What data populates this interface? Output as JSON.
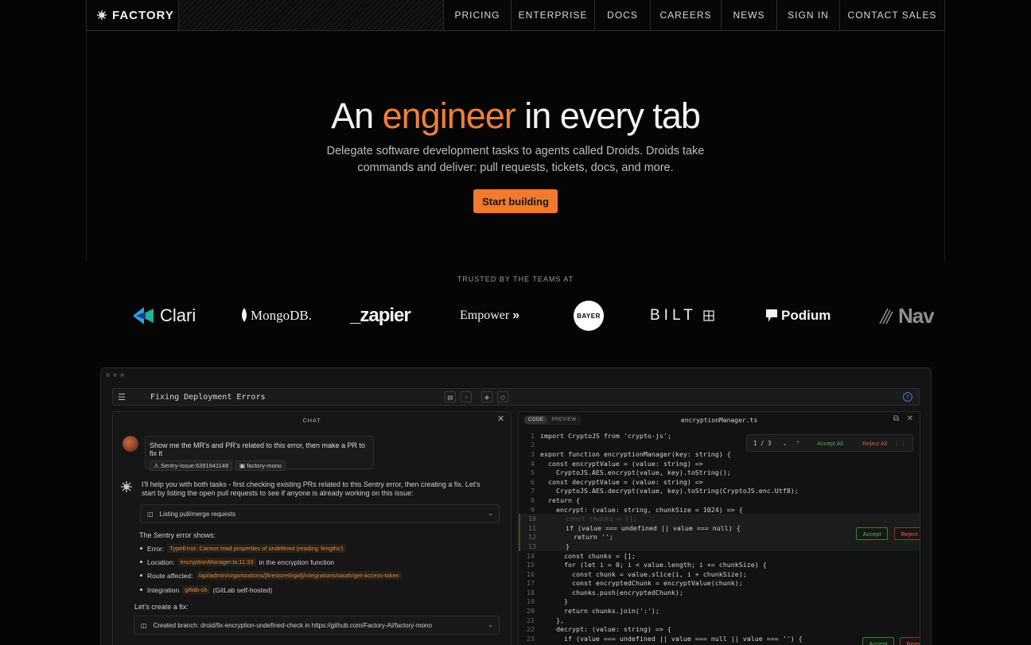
{
  "nav": {
    "brand": "FACTORY",
    "links": [
      "PRICING",
      "ENTERPRISE",
      "DOCS",
      "CAREERS",
      "NEWS",
      "SIGN IN",
      "CONTACT SALES"
    ]
  },
  "hero": {
    "title_pre": "An ",
    "title_accent": "engineer",
    "title_post": " in every tab",
    "subtitle": "Delegate software development tasks to agents called Droids. Droids take commands and deliver: pull requests, tickets, docs, and more.",
    "cta": "Start building"
  },
  "trusted": {
    "label": "TRUSTED BY THE TEAMS AT",
    "logos": [
      "Clari",
      "MongoDB.",
      "_zapier",
      "Empower",
      "BAYER",
      "BILT",
      "Podium",
      "Nav"
    ]
  },
  "colors": {
    "accent": "#ef7f3a",
    "cta": "#f07a2e",
    "accept": "#5fb35a",
    "reject": "#e06050"
  },
  "app": {
    "title": "Fixing Deployment Errors",
    "chat": {
      "header": "CHAT",
      "user_message": "Show me the MR's and PR's related to this error, then make a PR to fix it",
      "chips": [
        "Sentry-Issue:6391941148",
        "factory-mono"
      ],
      "bot_intro": "I'll help you with both tasks - first checking existing PRs related to this Sentry error, then creating a fix. Let's start by listing the open pull requests to see if anyone is already working on this issue:",
      "tool_call_1": "Listing pull/merge requests",
      "sentry_label": "The Sentry error shows:",
      "bullets": [
        {
          "label": "Error:",
          "code": "TypeError: Cannot read properties of undefined (reading 'lengths')",
          "after": ""
        },
        {
          "label": "Location:",
          "code": "encryptionManager.ts:11:33",
          "after": "in the encryption function"
        },
        {
          "label": "Route affected:",
          "code": "/api/admin/organizations/[firestore0rgid]/integrations/oauth/get-access-token",
          "after": ""
        },
        {
          "label": "Integration",
          "code": "gitlab-sh",
          "after": "(GitLab self-hosted)"
        }
      ],
      "fix_label": "Let's create a fix:",
      "tool_call_2": "Created branch: droid/fix-encryption-undefined-check in https://github.com/Factory-AI/factory-mono"
    },
    "editor": {
      "tabs": [
        "CODE",
        "PREVIEW"
      ],
      "filename": "encryptionManager.ts",
      "diff_count": "1 / 3",
      "accept_all": "Accept All",
      "reject_all": "Reject All",
      "accept": "Accept",
      "reject": "Reject",
      "lines": [
        "import CryptoJS from 'crypto-js';",
        "",
        "export function encryptionManager(key: string) {",
        "  const encryptValue = (value: string) =>",
        "    CryptoJS.AES.encrypt(value, key).toString();",
        "  const decryptValue = (value: string) =>",
        "    CryptoJS.AES.decrypt(value, key).toString(CryptoJS.enc.Utf8);",
        "  return {",
        "    encrypt: (value: string, chunkSize = 1024) => {",
        "      const chunks = [];",
        "      if (value === undefined || value === null) {",
        "        return '';",
        "      }",
        "      const chunks = [];",
        "      for (let i = 0; i < value.length; i += chunkSize) {",
        "        const chunk = value.slice(i, i + chunkSize);",
        "        const encryptedChunk = encryptValue(chunk);",
        "        chunks.push(encryptedChunk);",
        "      }",
        "      return chunks.join(':');",
        "    },",
        "    decrypt: (value: string) => {",
        "      if (value === undefined || value === null || value === '') {"
      ]
    }
  }
}
